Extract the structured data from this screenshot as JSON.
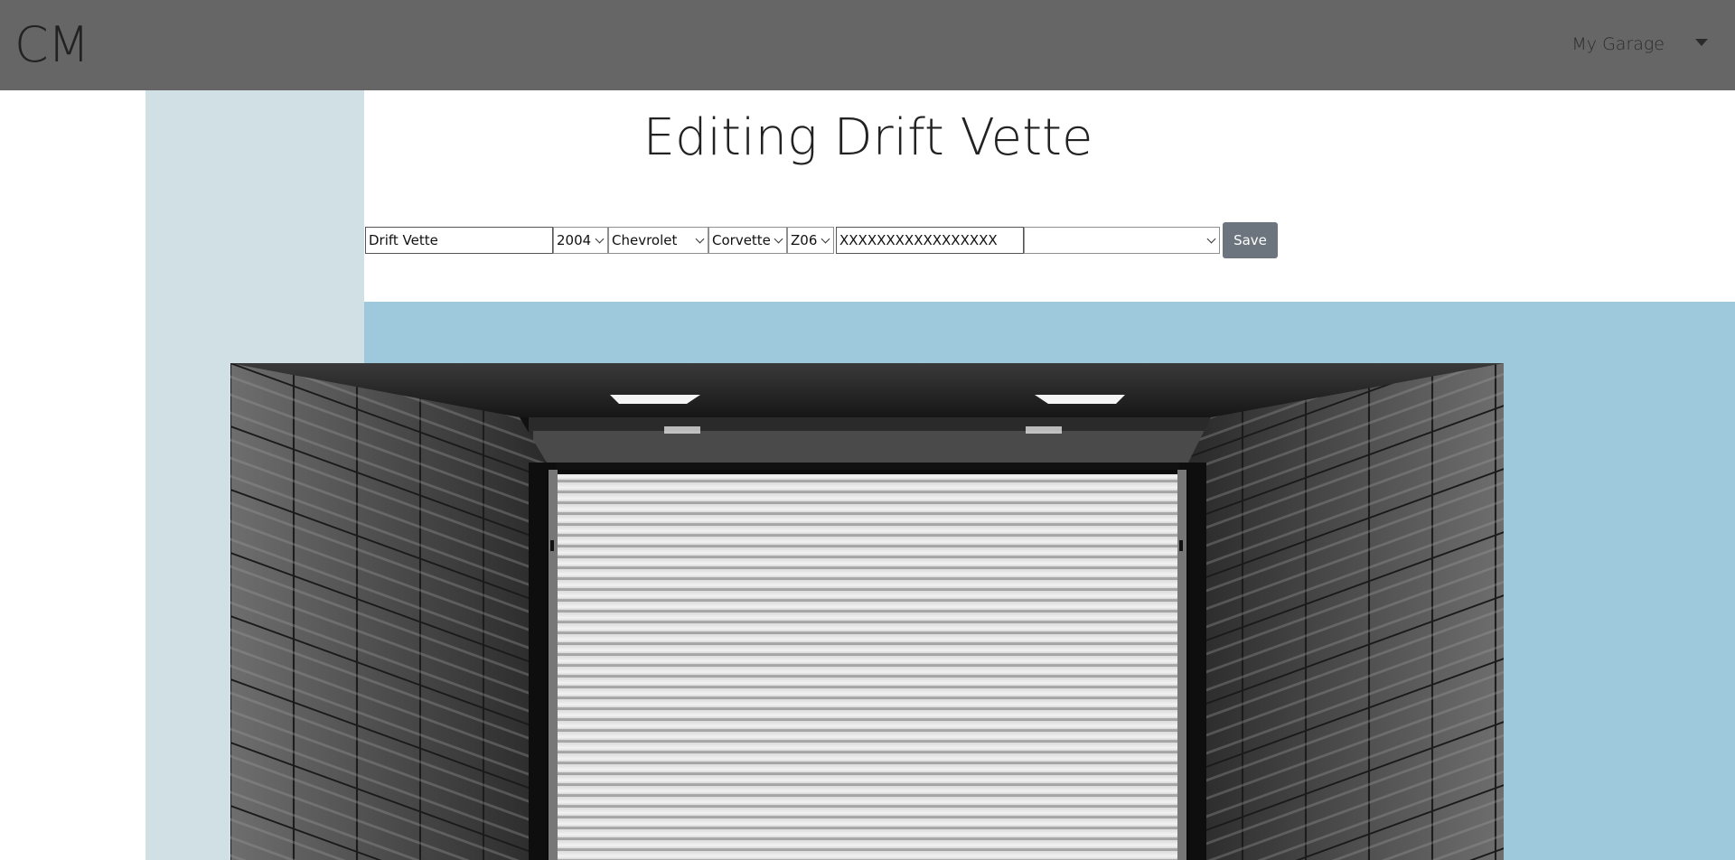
{
  "header": {
    "brand": "CM",
    "menu_label": "My Garage"
  },
  "page": {
    "title": "Editing Drift Vette"
  },
  "form": {
    "name_value": "Drift Vette",
    "year_value": "2004",
    "make_value": "Chevrolet",
    "model_value": "Corvette",
    "trim_value": "Z06",
    "vin_value": "XXXXXXXXXXXXXXXXX",
    "extra_select_value": "",
    "save_label": "Save"
  },
  "colors": {
    "topbar": "#666666",
    "sidebar": "#d1e0e4",
    "band": "#9ec9dc",
    "button": "#6c757d"
  },
  "image": {
    "subject": "garage-roll-up-door-photo"
  }
}
